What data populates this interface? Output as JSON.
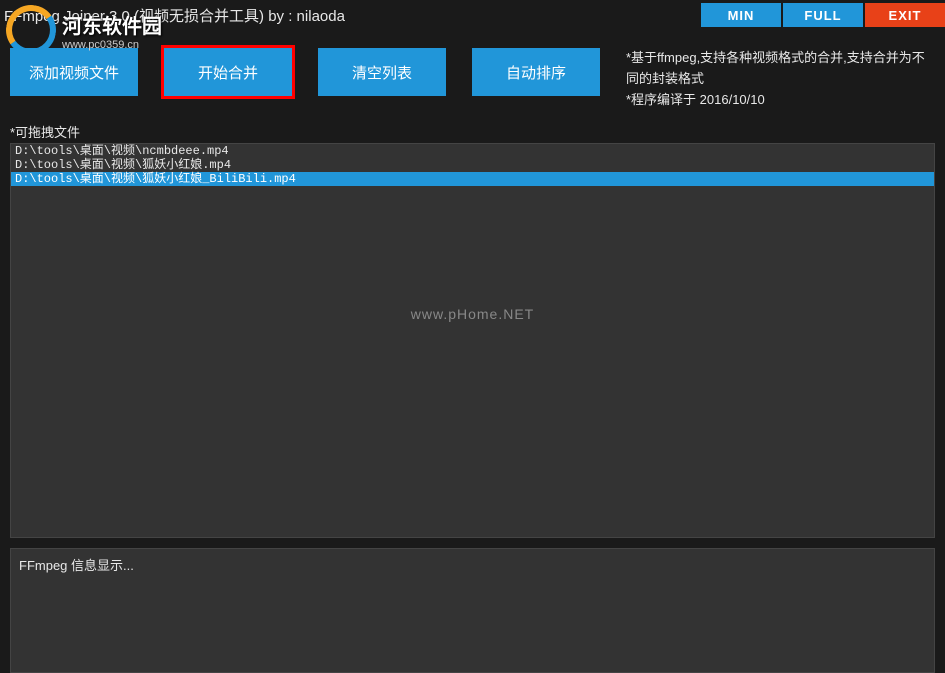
{
  "titlebar": {
    "title": "FFmpeg Joiner 3.0  (视频无损合并工具)   by : nilaoda",
    "min": "MIN",
    "full": "FULL",
    "exit": "EXIT"
  },
  "toolbar": {
    "add_video": "添加视频文件",
    "start_merge": "开始合并",
    "clear_list": "清空列表",
    "auto_sort": "自动排序"
  },
  "info": {
    "line1": "*基于ffmpeg,支持各种视频格式的合并,支持合并为不同的封装格式",
    "line2": "*程序编译于 2016/10/10"
  },
  "file_list": {
    "label": "*可拖拽文件",
    "items": [
      {
        "path": "D:\\tools\\桌面\\视频\\ncmbdeee.mp4",
        "selected": false
      },
      {
        "path": "D:\\tools\\桌面\\视频\\狐妖小红娘.mp4",
        "selected": false
      },
      {
        "path": "D:\\tools\\桌面\\视频\\狐妖小红娘_BiliBili.mp4",
        "selected": true
      }
    ]
  },
  "output": {
    "text": "FFmpeg 信息显示..."
  },
  "watermarks": {
    "phome": "www.pHome.NET",
    "logo_main": "河东软件园",
    "logo_sub": "www.pc0359.cn"
  }
}
